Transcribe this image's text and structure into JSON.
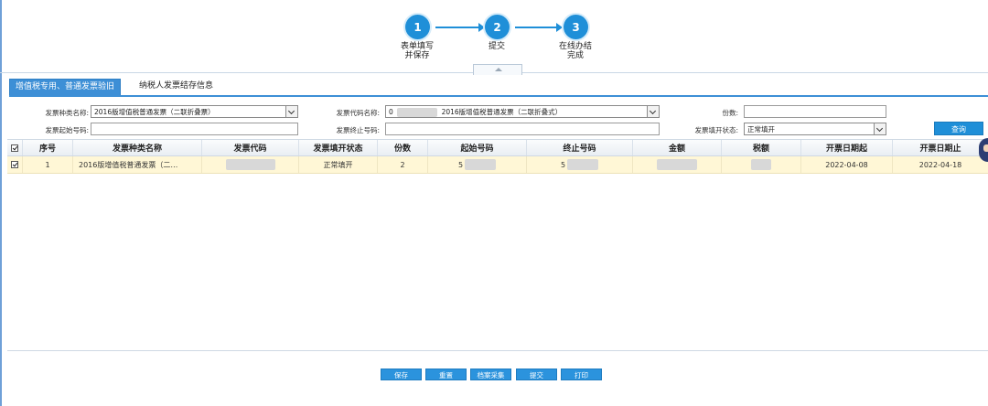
{
  "steps": [
    {
      "number": "1",
      "label_line1": "表单填写",
      "label_line2": "并保存"
    },
    {
      "number": "2",
      "label_line1": "提交",
      "label_line2": ""
    },
    {
      "number": "3",
      "label_line1": "在线办结",
      "label_line2": "完成"
    }
  ],
  "tabs": [
    {
      "label": "增值税专用、普通发票验旧",
      "active": true
    },
    {
      "label": "纳税人发票结存信息",
      "active": false
    }
  ],
  "form": {
    "invoice_type_label": "发票种类名称:",
    "invoice_type_value": "2016版增值税普通发票（二联折叠票）",
    "invoice_code_name_label": "发票代码名称:",
    "invoice_code_name_prefix": "0",
    "invoice_code_name_value": "2016版增值税普通发票（二联折叠式）",
    "count_label": "份数:",
    "count_value": "",
    "start_no_label": "发票起始号码:",
    "start_no_value": "",
    "end_no_label": "发票终止号码:",
    "end_no_value": "",
    "status_label": "发票填开状态:",
    "status_value": "正常填开",
    "query_button": "查询"
  },
  "grid": {
    "headers": [
      "序号",
      "发票种类名称",
      "发票代码",
      "发票填开状态",
      "份数",
      "起始号码",
      "终止号码",
      "金额",
      "税额",
      "开票日期起",
      "开票日期止"
    ],
    "rows": [
      {
        "checked": true,
        "index": "1",
        "invoice_type": "2016版增值税普通发票（二…",
        "invoice_code": "",
        "status": "正常填开",
        "count": "2",
        "start_no": "5",
        "end_no": "5",
        "amount": "",
        "tax": "",
        "date_from": "2022-04-08",
        "date_to": "2022-04-18"
      }
    ]
  },
  "buttons": {
    "save": "保存",
    "reset": "重置",
    "archive_collect": "档案采集",
    "submit": "提交",
    "print": "打印"
  },
  "colors": {
    "accent": "#1f8fd8",
    "row_highlight": "#fff7d6"
  }
}
